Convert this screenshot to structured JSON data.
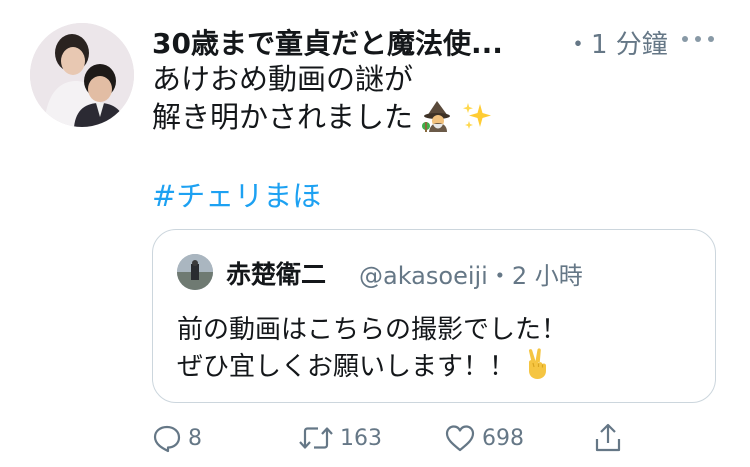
{
  "tweet": {
    "author_name": "30歳まで童貞だと魔法使...",
    "time": "・1 分鐘",
    "more_icon": "more-horizontal-icon",
    "text_lines": [
      "あけおめ動画の謎が",
      "解き明かされました"
    ],
    "emojis": [
      "mage-emoji",
      "sparkles-emoji"
    ],
    "hashtag": "#チェリまほ"
  },
  "quoted_tweet": {
    "author_name": "赤楚衛二",
    "handle_time": "@akasoeiji・2 小時",
    "text_lines": [
      "前の動画はこちらの撮影でした！",
      "ぜひ宜しくお願いします！！"
    ],
    "emoji": "victory-hand-emoji"
  },
  "actions": {
    "reply_count": "8",
    "retweet_count": "163",
    "like_count": "698",
    "reply_icon": "reply-icon",
    "retweet_icon": "retweet-icon",
    "like_icon": "heart-icon",
    "share_icon": "share-icon"
  },
  "colors": {
    "text": "#14171a",
    "secondary": "#657786",
    "link": "#1da1f2",
    "border": "#ccd6dd"
  }
}
